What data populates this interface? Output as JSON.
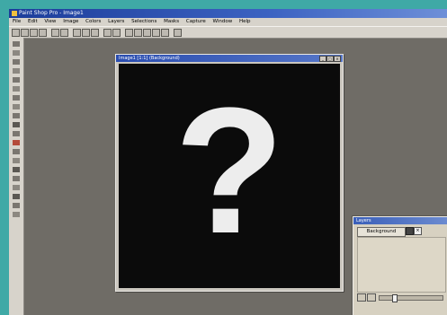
{
  "app": {
    "title": "Paint Shop Pro - Image1"
  },
  "menu": {
    "items": [
      "File",
      "Edit",
      "View",
      "Image",
      "Colors",
      "Layers",
      "Selections",
      "Masks",
      "Capture",
      "Window",
      "Help"
    ]
  },
  "toolbar": {
    "buttons": [
      "new-icon",
      "open-icon",
      "save-icon",
      "print-icon",
      "undo-icon",
      "redo-icon",
      "cut-icon",
      "copy-icon",
      "paste-icon",
      "full-screen-icon",
      "zoom-icon",
      "toggle-palette-icon",
      "tool-options-icon",
      "color-palette-icon",
      "layers-palette-icon",
      "histogram-icon",
      "help-icon"
    ]
  },
  "toolbox": {
    "tools": [
      "arrow-icon",
      "zoom-icon",
      "deform-icon",
      "crop-icon",
      "mover-icon",
      "selection-icon",
      "freehand-icon",
      "magic-wand-icon",
      "dropper-icon",
      "paint-brush-icon",
      "clone-brush-icon",
      "color-replacer-icon",
      "retouch-icon",
      "eraser-icon",
      "picture-tube-icon",
      "airbrush-icon",
      "flood-fill-icon",
      "text-icon",
      "draw-icon",
      "preset-shapes-icon"
    ]
  },
  "image_window": {
    "title": "Image1 [1:1] (Background)",
    "canvas_glyph": "?",
    "controls": [
      "_",
      "□",
      "×"
    ]
  },
  "layers": {
    "title": "Layers",
    "layer_name": "Background",
    "link_symbol": "×"
  },
  "colors": {
    "desktop": "#3fa9a6",
    "workspace": "#6f6c66",
    "canvas": "#0b0b0b",
    "glyph": "#ededed"
  }
}
